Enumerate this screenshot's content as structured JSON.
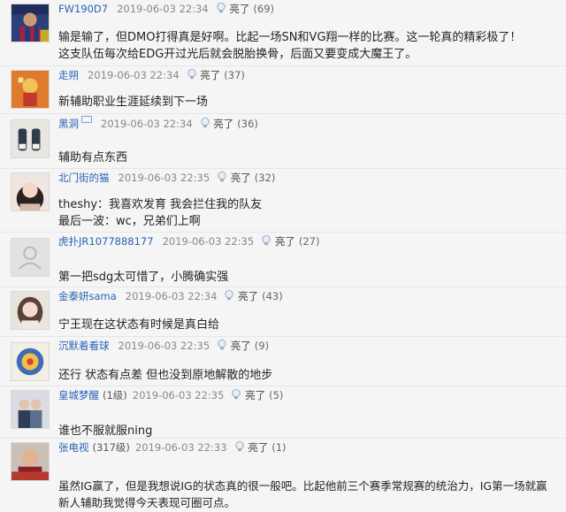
{
  "light_label": "亮了",
  "comments": [
    {
      "user": "FW190D7",
      "level": "",
      "time": "2019-06-03 22:34",
      "count": "(69)",
      "lines": [
        "输是输了，但DMO打得真是好啊。比起一场SN和VG翔一样的比赛。这一轮真的精彩极了！",
        "这支队伍每次给EDG开过光后就会脱胎换骨，后面又要变成大魔王了。"
      ]
    },
    {
      "user": "走朔",
      "level": "",
      "time": "2019-06-03 22:34",
      "count": "(37)",
      "lines": [
        "新辅助职业生涯延续到下一场"
      ]
    },
    {
      "user": "黑洞",
      "level": "",
      "time": "2019-06-03 22:34",
      "count": "(36)",
      "lines": [
        "辅助有点东西"
      ]
    },
    {
      "user": "北门街的猫",
      "level": "",
      "time": "2019-06-03 22:35",
      "count": "(32)",
      "lines": [
        "theshy：我喜欢发育 我会拦住我的队友",
        "最后一波：wc，兄弟们上啊"
      ]
    },
    {
      "user": "虎扑JR1077888177",
      "level": "",
      "time": "2019-06-03 22:35",
      "count": "(27)",
      "lines": [
        "第一把sdg太可惜了，小腾确实强"
      ]
    },
    {
      "user": "金泰妍sama",
      "level": "",
      "time": "2019-06-03 22:34",
      "count": "(43)",
      "lines": [
        "宁王现在这状态有时候是真白给"
      ]
    },
    {
      "user": "沉默着看球",
      "level": "",
      "time": "2019-06-03 22:35",
      "count": "(9)",
      "lines": [
        "还行 状态有点差 但也没到原地解散的地步"
      ]
    },
    {
      "user": "皇城梦醒",
      "level": "(1级)",
      "time": "2019-06-03 22:35",
      "count": "(5)",
      "lines": [
        "谁也不服就服ning"
      ]
    },
    {
      "user": "张电视",
      "level": "(317级)",
      "time": "2019-06-03 22:33",
      "count": "(1)",
      "lines": [
        "虽然IG赢了，但是我想说IG的状态真的很一般吧。比起他前三个赛季常规赛的统治力，IG第一场就赢",
        "新人辅助我觉得今天表现可圈可点。"
      ]
    }
  ]
}
